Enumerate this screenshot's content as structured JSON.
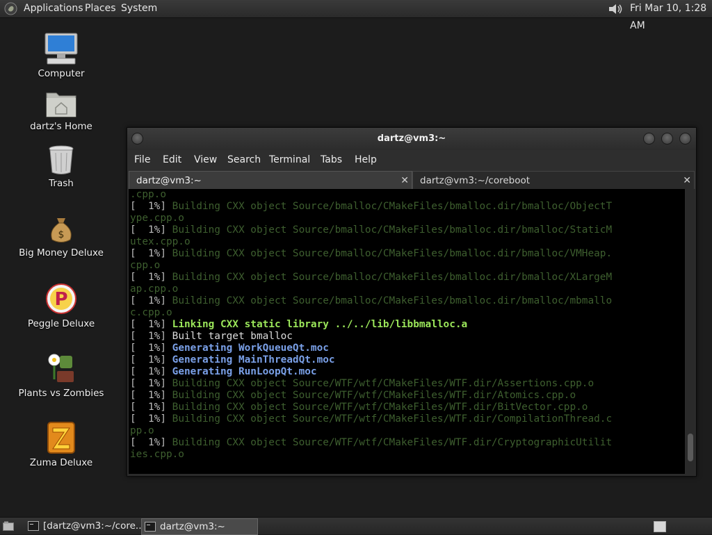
{
  "top_panel": {
    "menus": [
      "Applications",
      "Places",
      "System"
    ],
    "clock": "Fri Mar 10,  1:28 AM",
    "icons": [
      "gnome-foot-icon",
      "volume-icon"
    ]
  },
  "desktop": {
    "icons": [
      {
        "label": "Computer",
        "icon": "computer-icon"
      },
      {
        "label": "dartz's Home",
        "icon": "home-folder-icon"
      },
      {
        "label": "Trash",
        "icon": "trash-icon"
      },
      {
        "label": "Big Money Deluxe",
        "icon": "money-bag-icon"
      },
      {
        "label": "Peggle Deluxe",
        "icon": "peggle-icon"
      },
      {
        "label": "Plants vs Zombies",
        "icon": "plants-vs-zombies-icon"
      },
      {
        "label": "Zuma Deluxe",
        "icon": "zuma-icon"
      }
    ]
  },
  "terminal": {
    "title": "dartz@vm3:~",
    "menu": [
      "File",
      "Edit",
      "View",
      "Search",
      "Terminal",
      "Tabs",
      "Help"
    ],
    "tabs": [
      {
        "label": "dartz@vm3:~",
        "active": true
      },
      {
        "label": "dartz@vm3:~/coreboot",
        "active": false
      }
    ],
    "lines": [
      {
        "t": ".cpp.o",
        "c": "dim"
      },
      {
        "p": "[  1%] ",
        "t": "Building CXX object Source/bmalloc/CMakeFiles/bmalloc.dir/bmalloc/ObjectT",
        "c": "dim"
      },
      {
        "t": "ype.cpp.o",
        "c": "dim"
      },
      {
        "p": "[  1%] ",
        "t": "Building CXX object Source/bmalloc/CMakeFiles/bmalloc.dir/bmalloc/StaticM",
        "c": "dim"
      },
      {
        "t": "utex.cpp.o",
        "c": "dim"
      },
      {
        "p": "[  1%] ",
        "t": "Building CXX object Source/bmalloc/CMakeFiles/bmalloc.dir/bmalloc/VMHeap.",
        "c": "dim"
      },
      {
        "t": "cpp.o",
        "c": "dim"
      },
      {
        "p": "[  1%] ",
        "t": "Building CXX object Source/bmalloc/CMakeFiles/bmalloc.dir/bmalloc/XLargeM",
        "c": "dim"
      },
      {
        "t": "ap.cpp.o",
        "c": "dim"
      },
      {
        "p": "[  1%] ",
        "t": "Building CXX object Source/bmalloc/CMakeFiles/bmalloc.dir/bmalloc/mbmallo",
        "c": "dim"
      },
      {
        "t": "c.cpp.o",
        "c": "dim"
      },
      {
        "p": "[  1%] ",
        "t": "Linking CXX static library ../../lib/libbmalloc.a",
        "c": "grn"
      },
      {
        "p": "[  1%] ",
        "t": "Built target bmalloc",
        "c": "wht"
      },
      {
        "p": "[  1%] ",
        "t": "Generating WorkQueueQt.moc",
        "c": "blue"
      },
      {
        "p": "[  1%] ",
        "t": "Generating MainThreadQt.moc",
        "c": "blue"
      },
      {
        "p": "[  1%] ",
        "t": "Generating RunLoopQt.moc",
        "c": "blue"
      },
      {
        "p": "[  1%] ",
        "t": "Building CXX object Source/WTF/wtf/CMakeFiles/WTF.dir/Assertions.cpp.o",
        "c": "dim"
      },
      {
        "p": "[  1%] ",
        "t": "Building CXX object Source/WTF/wtf/CMakeFiles/WTF.dir/Atomics.cpp.o",
        "c": "dim"
      },
      {
        "p": "[  1%] ",
        "t": "Building CXX object Source/WTF/wtf/CMakeFiles/WTF.dir/BitVector.cpp.o",
        "c": "dim"
      },
      {
        "p": "[  1%] ",
        "t": "Building CXX object Source/WTF/wtf/CMakeFiles/WTF.dir/CompilationThread.c",
        "c": "dim"
      },
      {
        "t": "pp.o",
        "c": "dim"
      },
      {
        "p": "[  1%] ",
        "t": "Building CXX object Source/WTF/wtf/CMakeFiles/WTF.dir/CryptographicUtilit",
        "c": "dim"
      },
      {
        "t": "ies.cpp.o",
        "c": "dim"
      }
    ]
  },
  "bottom_panel": {
    "tasks": [
      {
        "label": "[dartz@vm3:~/core...",
        "active": false
      },
      {
        "label": "dartz@vm3:~",
        "active": true
      }
    ],
    "icons": [
      "show-desktop-icon",
      "workspace-switcher-icon"
    ]
  }
}
